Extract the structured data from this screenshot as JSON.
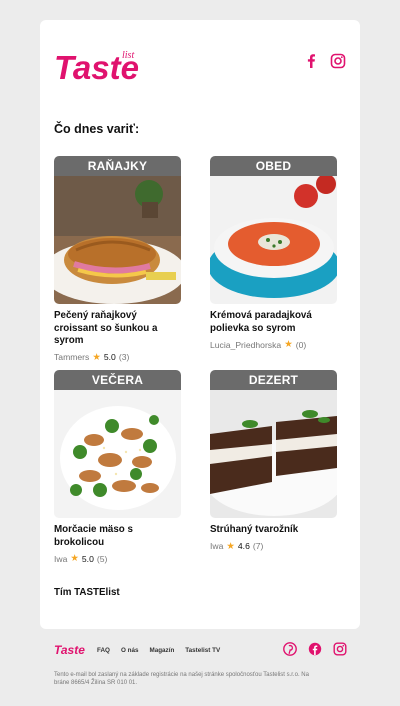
{
  "brand": {
    "logo_text": "Taste",
    "logo_sub": "list",
    "accent": "#e0126e"
  },
  "header": {
    "social": [
      "facebook-icon",
      "instagram-icon"
    ]
  },
  "heading": "Čo dnes variť:",
  "recipes": [
    {
      "category": "RAŇAJKY",
      "title": "Pečený raňajkový croissant so šunkou a syrom",
      "author": "Tammers",
      "rating": "5.0",
      "count": "(3)"
    },
    {
      "category": "OBED",
      "title": "Krémová paradajková polievka so syrom",
      "author": "Lucia_Priedhorska",
      "rating": "",
      "count": "(0)"
    },
    {
      "category": "VEČERA",
      "title": "Morčacie mäso s brokolicou",
      "author": "Iwa",
      "rating": "5.0",
      "count": "(5)"
    },
    {
      "category": "DEZERT",
      "title": "Strúhaný tvarožník",
      "author": "Iwa",
      "rating": "4.6",
      "count": "(7)"
    }
  ],
  "team": "Tím TASTElist",
  "footer": {
    "links": [
      "FAQ",
      "O nás",
      "Magazín",
      "Tastelist TV"
    ],
    "social": [
      "pinterest-icon",
      "facebook-icon",
      "instagram-icon"
    ],
    "disclaimer": "Tento e-mail bol zaslaný na základe registrácie na našej stránke spoločnosťou Tastelist s.r.o. Na bráne 8665/4 Žilina SR 010 01."
  }
}
